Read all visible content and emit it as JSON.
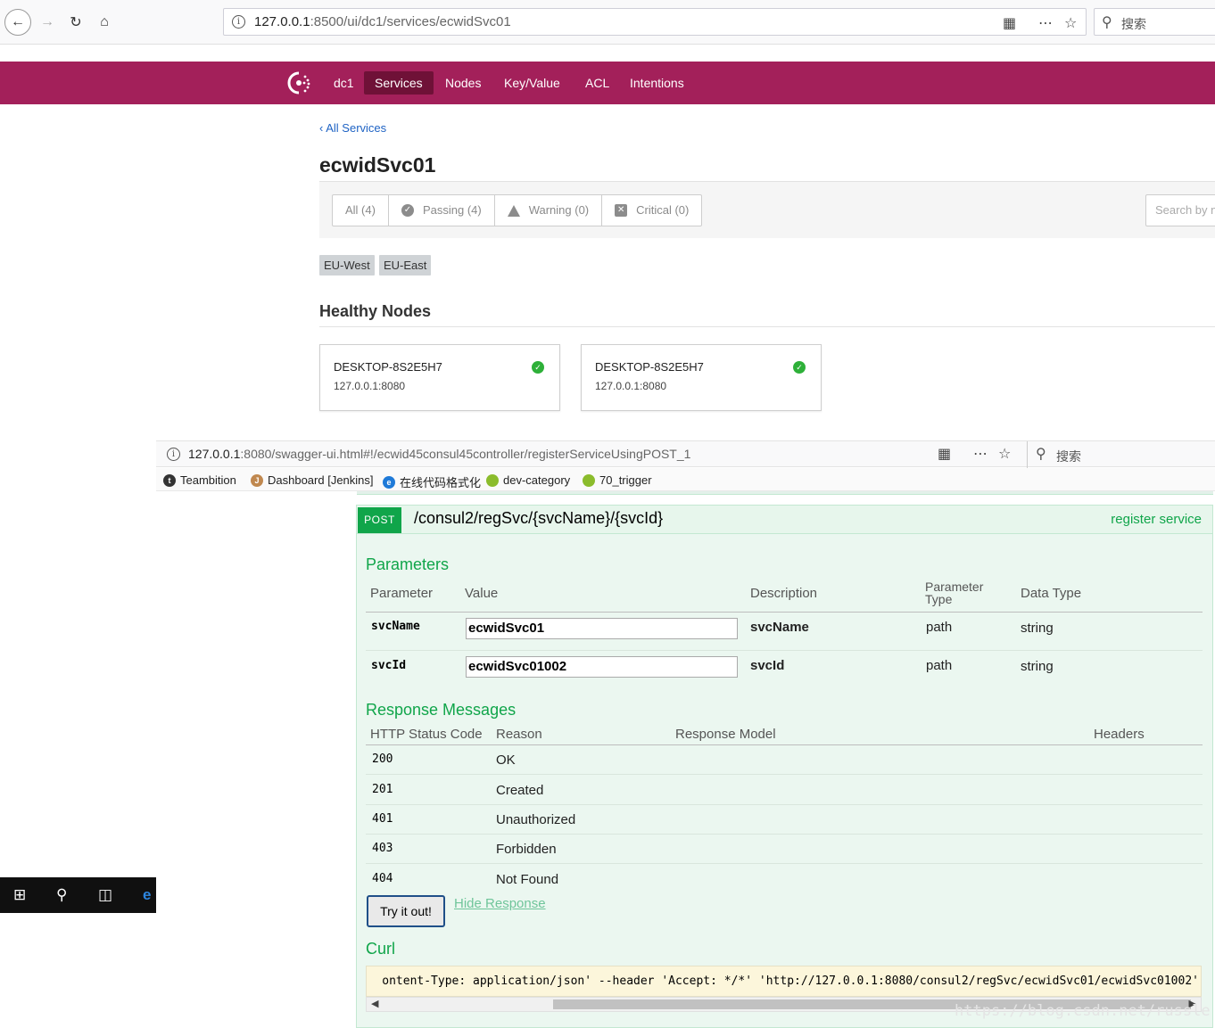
{
  "browser1": {
    "url_host": "127.0.0.1",
    "url_rest": ":8500/ui/dc1/services/ecwidSvc01",
    "search_placeholder": "搜索"
  },
  "consul": {
    "nav": {
      "datacenter": "dc1",
      "items": [
        {
          "label": "Services",
          "active": true
        },
        {
          "label": "Nodes",
          "active": false
        },
        {
          "label": "Key/Value",
          "active": false
        },
        {
          "label": "ACL",
          "active": false
        },
        {
          "label": "Intentions",
          "active": false
        }
      ]
    },
    "back_link": "All Services",
    "service_name": "ecwidSvc01",
    "filters": [
      {
        "label": "All (4)",
        "icon": "none"
      },
      {
        "label": "Passing (4)",
        "icon": "check-circle-icon"
      },
      {
        "label": "Warning (0)",
        "icon": "warning-icon"
      },
      {
        "label": "Critical (0)",
        "icon": "critical-icon"
      }
    ],
    "search_placeholder": "Search by n",
    "tags": [
      "EU-West",
      "EU-East"
    ],
    "healthy_nodes_heading": "Healthy Nodes",
    "nodes": [
      {
        "name": "DESKTOP-8S2E5H7",
        "address": "127.0.0.1:8080"
      },
      {
        "name": "DESKTOP-8S2E5H7",
        "address": "127.0.0.1:8080"
      }
    ],
    "colors": {
      "nav_bg": "#a3205a",
      "nav_active": "#6f1137",
      "passing": "#2eb039",
      "link": "#1f63c4"
    }
  },
  "browser2": {
    "url_host": "127.0.0.1",
    "url_rest": ":8080/swagger-ui.html#!/ecwid45consul45controller/registerServiceUsingPOST_1",
    "search_placeholder": "搜索",
    "bookmarks": [
      {
        "label": "Teambition",
        "icon": "teambition-icon",
        "color": "#333333"
      },
      {
        "label": "Dashboard [Jenkins]",
        "icon": "jenkins-icon",
        "color": "#c0884f"
      },
      {
        "label": "在线代码格式化",
        "icon": "edge-icon",
        "color": "#1f7ad8"
      },
      {
        "label": "dev-category",
        "icon": "greenball-icon",
        "color": "#8bbc2c"
      },
      {
        "label": "70_trigger",
        "icon": "greenball-icon",
        "color": "#8bbc2c"
      }
    ]
  },
  "swagger": {
    "method": "POST",
    "path": "/consul2/regSvc/{svcName}/{svcId}",
    "summary": "register service",
    "parameters_heading": "Parameters",
    "param_headers": {
      "parameter": "Parameter",
      "value": "Value",
      "description": "Description",
      "parameter_type_1": "Parameter",
      "parameter_type_2": "Type",
      "data_type": "Data Type"
    },
    "params": [
      {
        "name": "svcName",
        "value": "ecwidSvc01",
        "description": "svcName",
        "type": "path",
        "data_type": "string"
      },
      {
        "name": "svcId",
        "value": "ecwidSvc01002",
        "description": "svcId",
        "type": "path",
        "data_type": "string"
      }
    ],
    "response_heading": "Response Messages",
    "response_headers": {
      "code": "HTTP Status Code",
      "reason": "Reason",
      "model": "Response Model",
      "headers": "Headers"
    },
    "responses": [
      {
        "code": "200",
        "reason": "OK"
      },
      {
        "code": "201",
        "reason": "Created"
      },
      {
        "code": "401",
        "reason": "Unauthorized"
      },
      {
        "code": "403",
        "reason": "Forbidden"
      },
      {
        "code": "404",
        "reason": "Not Found"
      }
    ],
    "try_button": "Try it out!",
    "hide_response": "Hide Response",
    "curl_heading": "Curl",
    "curl_command": "ontent-Type: application/json' --header 'Accept: */*' 'http://127.0.0.1:8080/consul2/regSvc/ecwidSvc01/ecwidSvc01002'",
    "colors": {
      "post_green": "#10a54a",
      "op_bg": "#ebf7f0",
      "curl_bg": "#fcf6db"
    }
  },
  "watermark": "https://blog.csdn.net/russle"
}
